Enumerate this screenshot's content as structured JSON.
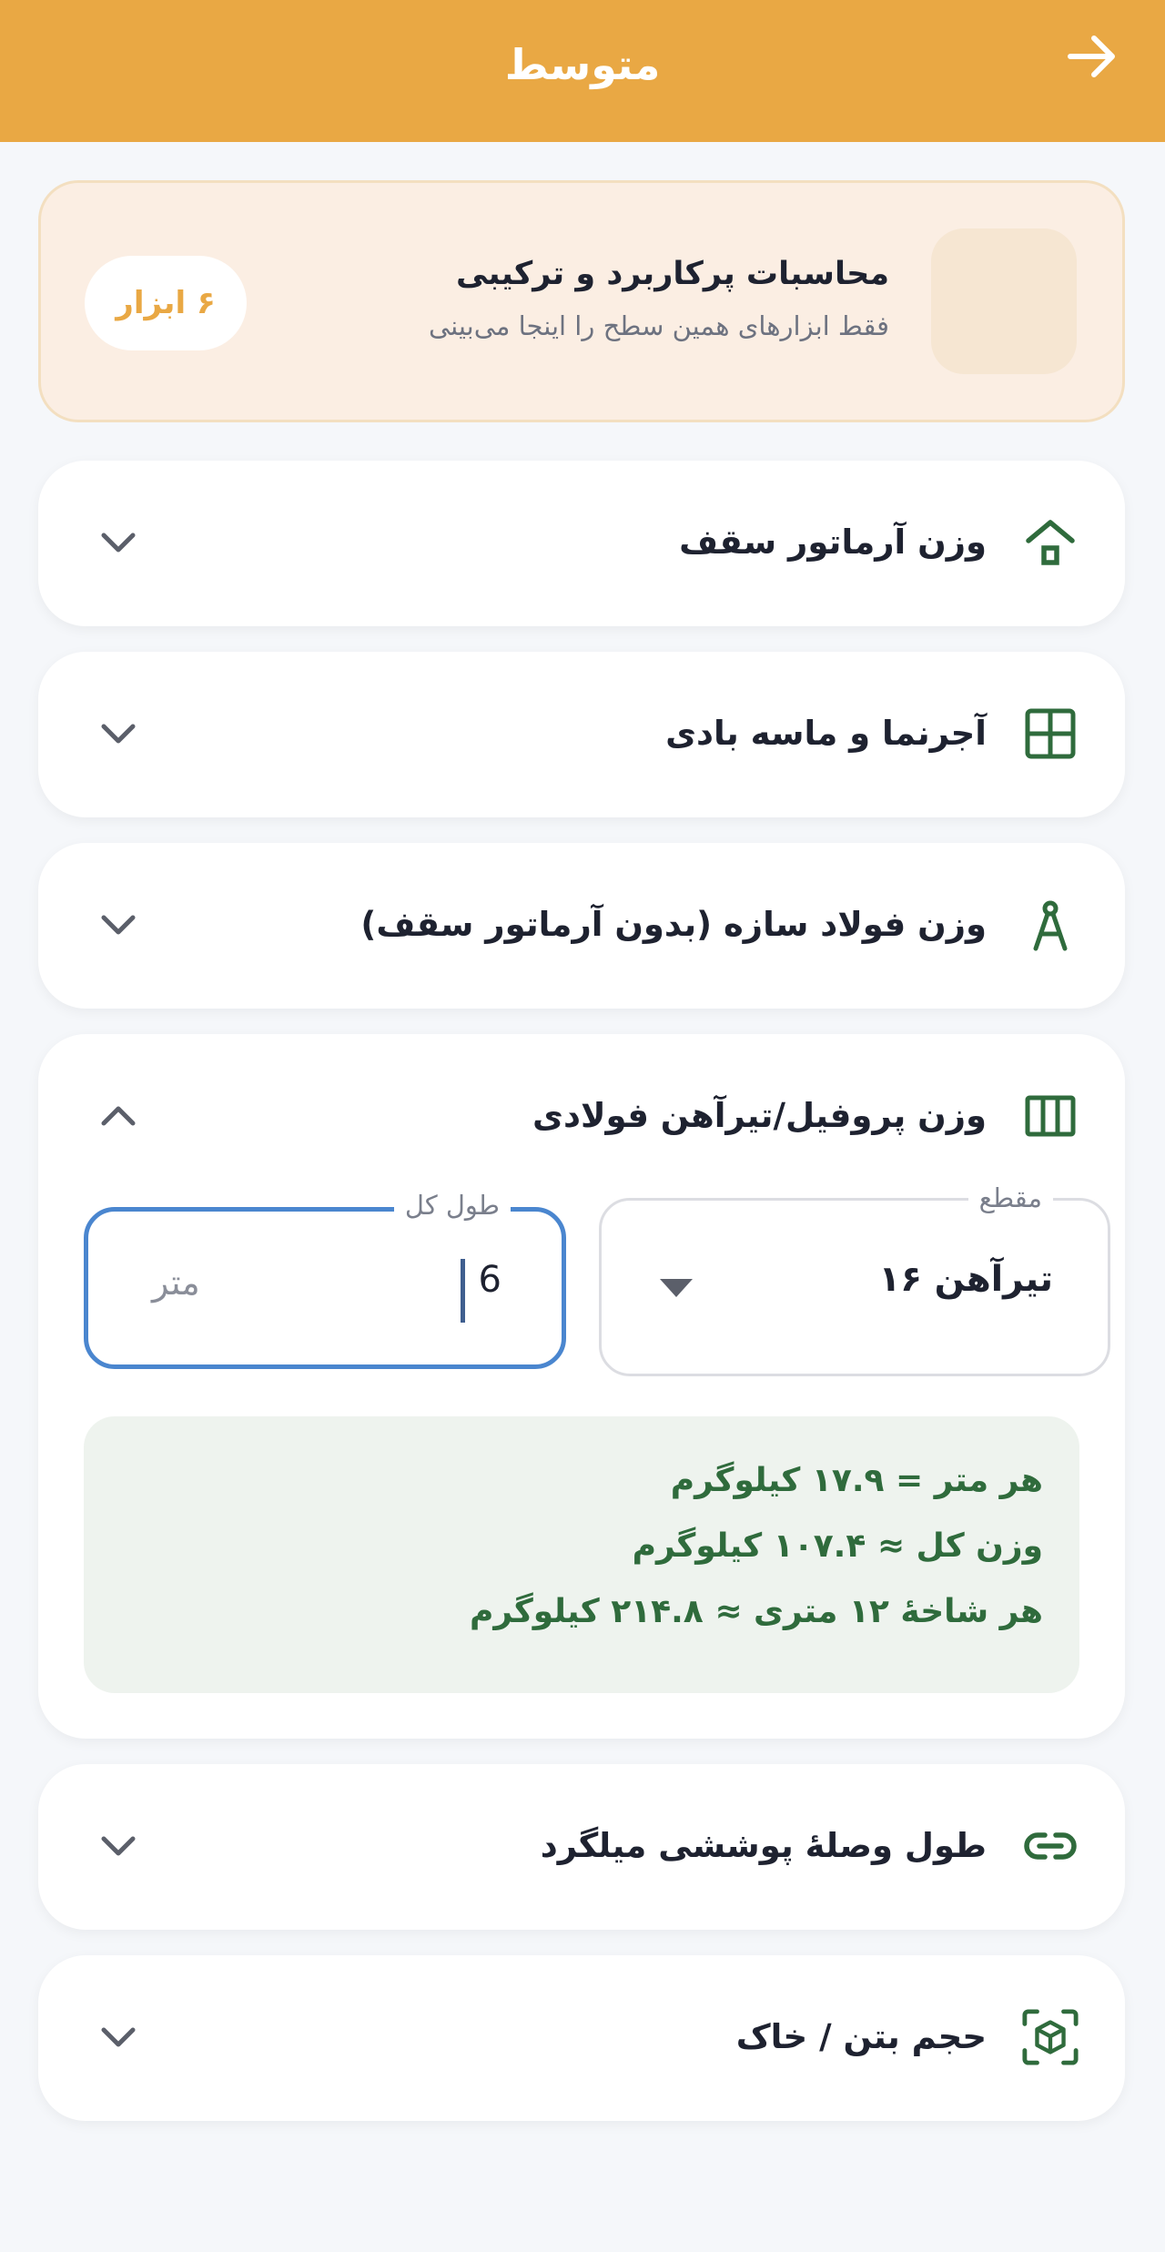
{
  "header": {
    "title": "متوسط",
    "back_icon": "arrow-right-icon"
  },
  "banner": {
    "title": "محاسبات پرکاربرد و ترکیبی",
    "subtitle": "فقط ابزارهای همین سطح را اینجا می‌بینی",
    "badge": "۶ ابزار"
  },
  "colors": {
    "primary": "#E9A844",
    "accent_green": "#2F6B3C",
    "focus_blue": "#4A86CF"
  },
  "tools": [
    {
      "title": "وزن آرماتور سقف",
      "icon": "house-icon",
      "expanded": false
    },
    {
      "title": "آجرنما و ماسه بادی",
      "icon": "grid-icon",
      "expanded": false
    },
    {
      "title": "وزن فولاد سازه (بدون آرماتور سقف)",
      "icon": "compass-icon",
      "expanded": false
    },
    {
      "title": "وزن پروفیل/تیرآهن فولادی",
      "icon": "columns-icon",
      "expanded": true
    },
    {
      "title": "طول وصلهٔ پوششی میلگرد",
      "icon": "link-icon",
      "expanded": false
    },
    {
      "title": "حجم بتن / خاک",
      "icon": "cube-scan-icon",
      "expanded": false
    }
  ],
  "profile_tool": {
    "section_label": "مقطع",
    "section_value": "تیرآهن ۱۶",
    "length_label": "طول کل",
    "length_value": "6",
    "length_unit": "متر",
    "results": [
      "هر متر = ۱۷.۹ کیلوگرم",
      "وزن کل ≈ ۱۰۷.۴ کیلوگرم",
      "هر شاخهٔ ۱۲ متری ≈ ۲۱۴.۸ کیلوگرم"
    ]
  }
}
